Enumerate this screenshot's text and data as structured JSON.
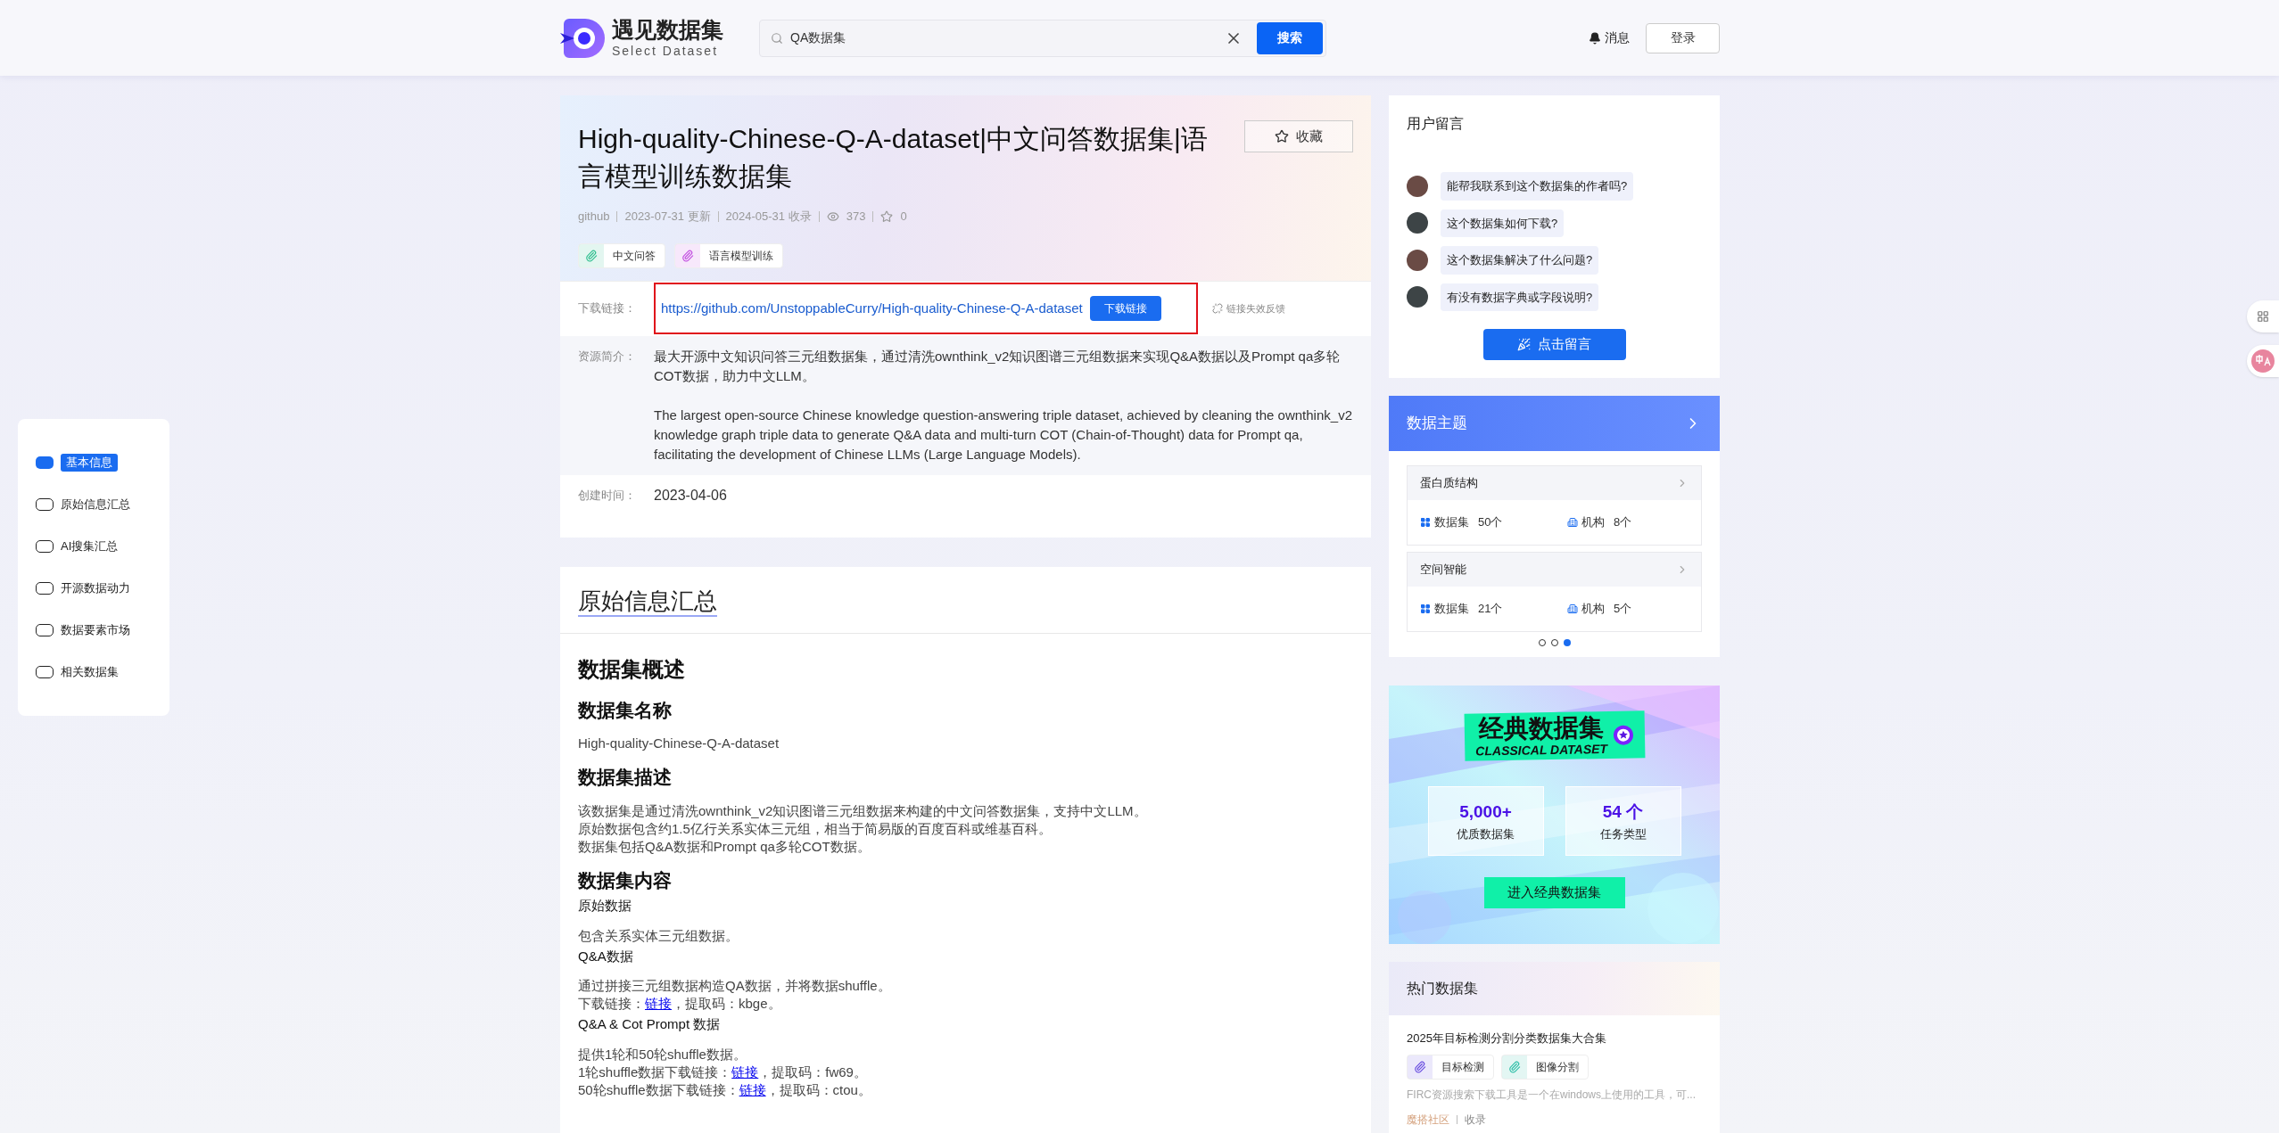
{
  "header": {
    "logo": {
      "title": "遇见数据集",
      "subtitle": "Select Dataset"
    },
    "search": {
      "value": "QA数据集"
    },
    "search_button": "搜索",
    "messages": "消息",
    "login": "登录"
  },
  "side_nav": {
    "items": [
      {
        "label": "基本信息",
        "selected": true
      },
      {
        "label": "原始信息汇总",
        "selected": false
      },
      {
        "label": "AI搜集汇总",
        "selected": false
      },
      {
        "label": "开源数据动力",
        "selected": false
      },
      {
        "label": "数据要素市场",
        "selected": false
      },
      {
        "label": "相关数据集",
        "selected": false
      }
    ]
  },
  "dataset": {
    "title": "High-quality-Chinese-Q-A-dataset|中文问答数据集|语言模型训练数据集",
    "favorite_button": "收藏",
    "meta": {
      "source": "github",
      "updated": "2023-07-31 更新",
      "collected": "2024-05-31 收录",
      "views": "373",
      "favorites": "0"
    },
    "tags": [
      {
        "label": "中文问答",
        "color": "#2fbf8f"
      },
      {
        "label": "语言模型训练",
        "color": "#c24fe0"
      }
    ],
    "download": {
      "label": "下载链接：",
      "url": "https://github.com/UnstoppableCurry/High-quality-Chinese-Q-A-dataset",
      "button": "下载链接",
      "report": "链接失效反馈"
    },
    "intro": {
      "label": "资源简介：",
      "paragraphs": [
        "最大开源中文知识问答三元组数据集，通过清洗ownthink_v2知识图谱三元组数据来实现Q&A数据以及Prompt qa多轮COT数据，助力中文LLM。",
        "The largest open-source Chinese knowledge question-answering triple dataset, achieved by cleaning the ownthink_v2 knowledge graph triple data to generate Q&A data and multi-turn COT (Chain-of-Thought) data for Prompt qa, facilitating the development of Chinese LLMs (Large Language Models)."
      ]
    },
    "created": {
      "label": "创建时间：",
      "value": "2023-04-06"
    }
  },
  "summary": {
    "title": "原始信息汇总",
    "blocks": [
      {
        "kind": "h2",
        "text": "数据集概述"
      },
      {
        "kind": "h3",
        "text": "数据集名称"
      },
      {
        "kind": "p",
        "lines": [
          {
            "text": "High-quality-Chinese-Q-A-dataset"
          }
        ]
      },
      {
        "kind": "h3",
        "text": "数据集描述"
      },
      {
        "kind": "p",
        "lines": [
          {
            "text": "该数据集是通过清洗ownthink_v2知识图谱三元组数据来构建的中文问答数据集，支持中文LLM。"
          },
          {
            "text": "原始数据包含约1.5亿行关系实体三元组，相当于简易版的百度百科或维基百科。"
          },
          {
            "text": "数据集包括Q&A数据和Prompt qa多轮COT数据。"
          }
        ]
      },
      {
        "kind": "h3",
        "text": "数据集内容"
      },
      {
        "kind": "sub",
        "text": "原始数据"
      },
      {
        "kind": "p",
        "lines": [
          {
            "text": "包含关系实体三元组数据。"
          }
        ]
      },
      {
        "kind": "sub",
        "text": "Q&A数据"
      },
      {
        "kind": "p",
        "lines": [
          {
            "text": "通过拼接三元组数据构造QA数据，并将数据shuffle。"
          },
          {
            "text": "下载链接：",
            "link": "链接",
            "after": "，提取码：kbge。"
          }
        ]
      },
      {
        "kind": "sub",
        "text": "Q&A & Cot Prompt 数据"
      },
      {
        "kind": "p",
        "lines": [
          {
            "text": "提供1轮和50轮shuffle数据。"
          },
          {
            "text": "1轮shuffle数据下载链接：",
            "link": "链接",
            "after": "，提取码：fw69。"
          },
          {
            "text": "50轮shuffle数据下载链接：",
            "link": "链接",
            "after": "，提取码：ctou。"
          }
        ]
      }
    ]
  },
  "comments": {
    "title": "用户留言",
    "messages": [
      "能帮我联系到这个数据集的作者吗?",
      "这个数据集如何下载?",
      "这个数据集解决了什么问题?",
      "有没有数据字典或字段说明?"
    ],
    "button": "点击留言"
  },
  "topics": {
    "title": "数据主题",
    "items": [
      {
        "name": "蛋白质结构",
        "datasets_label": "数据集",
        "datasets": "50个",
        "orgs_label": "机构",
        "orgs": "8个"
      },
      {
        "name": "空间智能",
        "datasets_label": "数据集",
        "datasets": "21个",
        "orgs_label": "机构",
        "orgs": "5个"
      }
    ],
    "dots": [
      {
        "selected": false
      },
      {
        "selected": false
      },
      {
        "selected": true
      }
    ]
  },
  "banner": {
    "title": "经典数据集",
    "subtitle": "CLASSICAL DATASET",
    "stats": [
      {
        "value": "5,000+",
        "label": "优质数据集"
      },
      {
        "value": "54 个",
        "label": "任务类型"
      }
    ],
    "button": "进入经典数据集"
  },
  "hot": {
    "title": "热门数据集",
    "items": [
      {
        "title": "2025年目标检测分割分类数据集大合集",
        "tags": [
          {
            "label": "目标检测",
            "color": "#6a4fe0"
          },
          {
            "label": "图像分割",
            "color": "#2fbfa8"
          }
        ],
        "desc": "FIRC资源搜索下载工具是一个在windows上使用的工具，可...",
        "source": "魔搭社区",
        "action": "收录"
      }
    ]
  }
}
